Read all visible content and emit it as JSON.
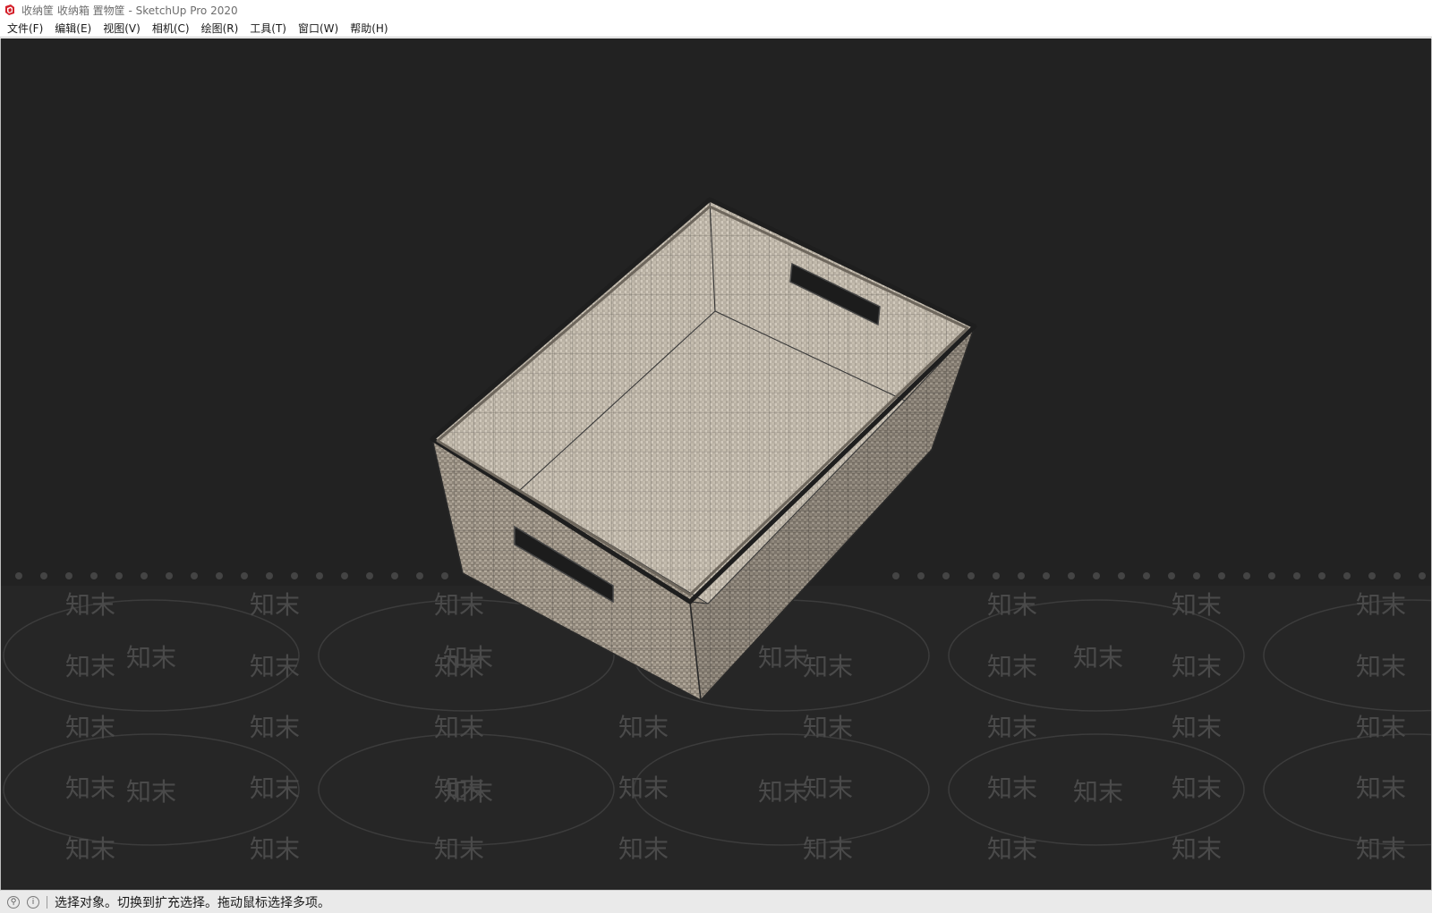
{
  "window": {
    "title": "收纳筐 收纳箱 置物筐 - SketchUp Pro 2020"
  },
  "menu": {
    "items": [
      {
        "label": "文件(F)"
      },
      {
        "label": "编辑(E)"
      },
      {
        "label": "视图(V)"
      },
      {
        "label": "相机(C)"
      },
      {
        "label": "绘图(R)"
      },
      {
        "label": "工具(T)"
      },
      {
        "label": "窗口(W)"
      },
      {
        "label": "帮助(H)"
      }
    ]
  },
  "viewport": {
    "background": "#222222",
    "model": "woven storage basket (wireframe texture)",
    "watermark_text": "知末",
    "watermark_color": "#4a4a4a"
  },
  "status": {
    "text": "选择对象。切换到扩充选择。拖动鼠标选择多项。",
    "icons": [
      "geo-location-icon",
      "info-icon"
    ]
  }
}
